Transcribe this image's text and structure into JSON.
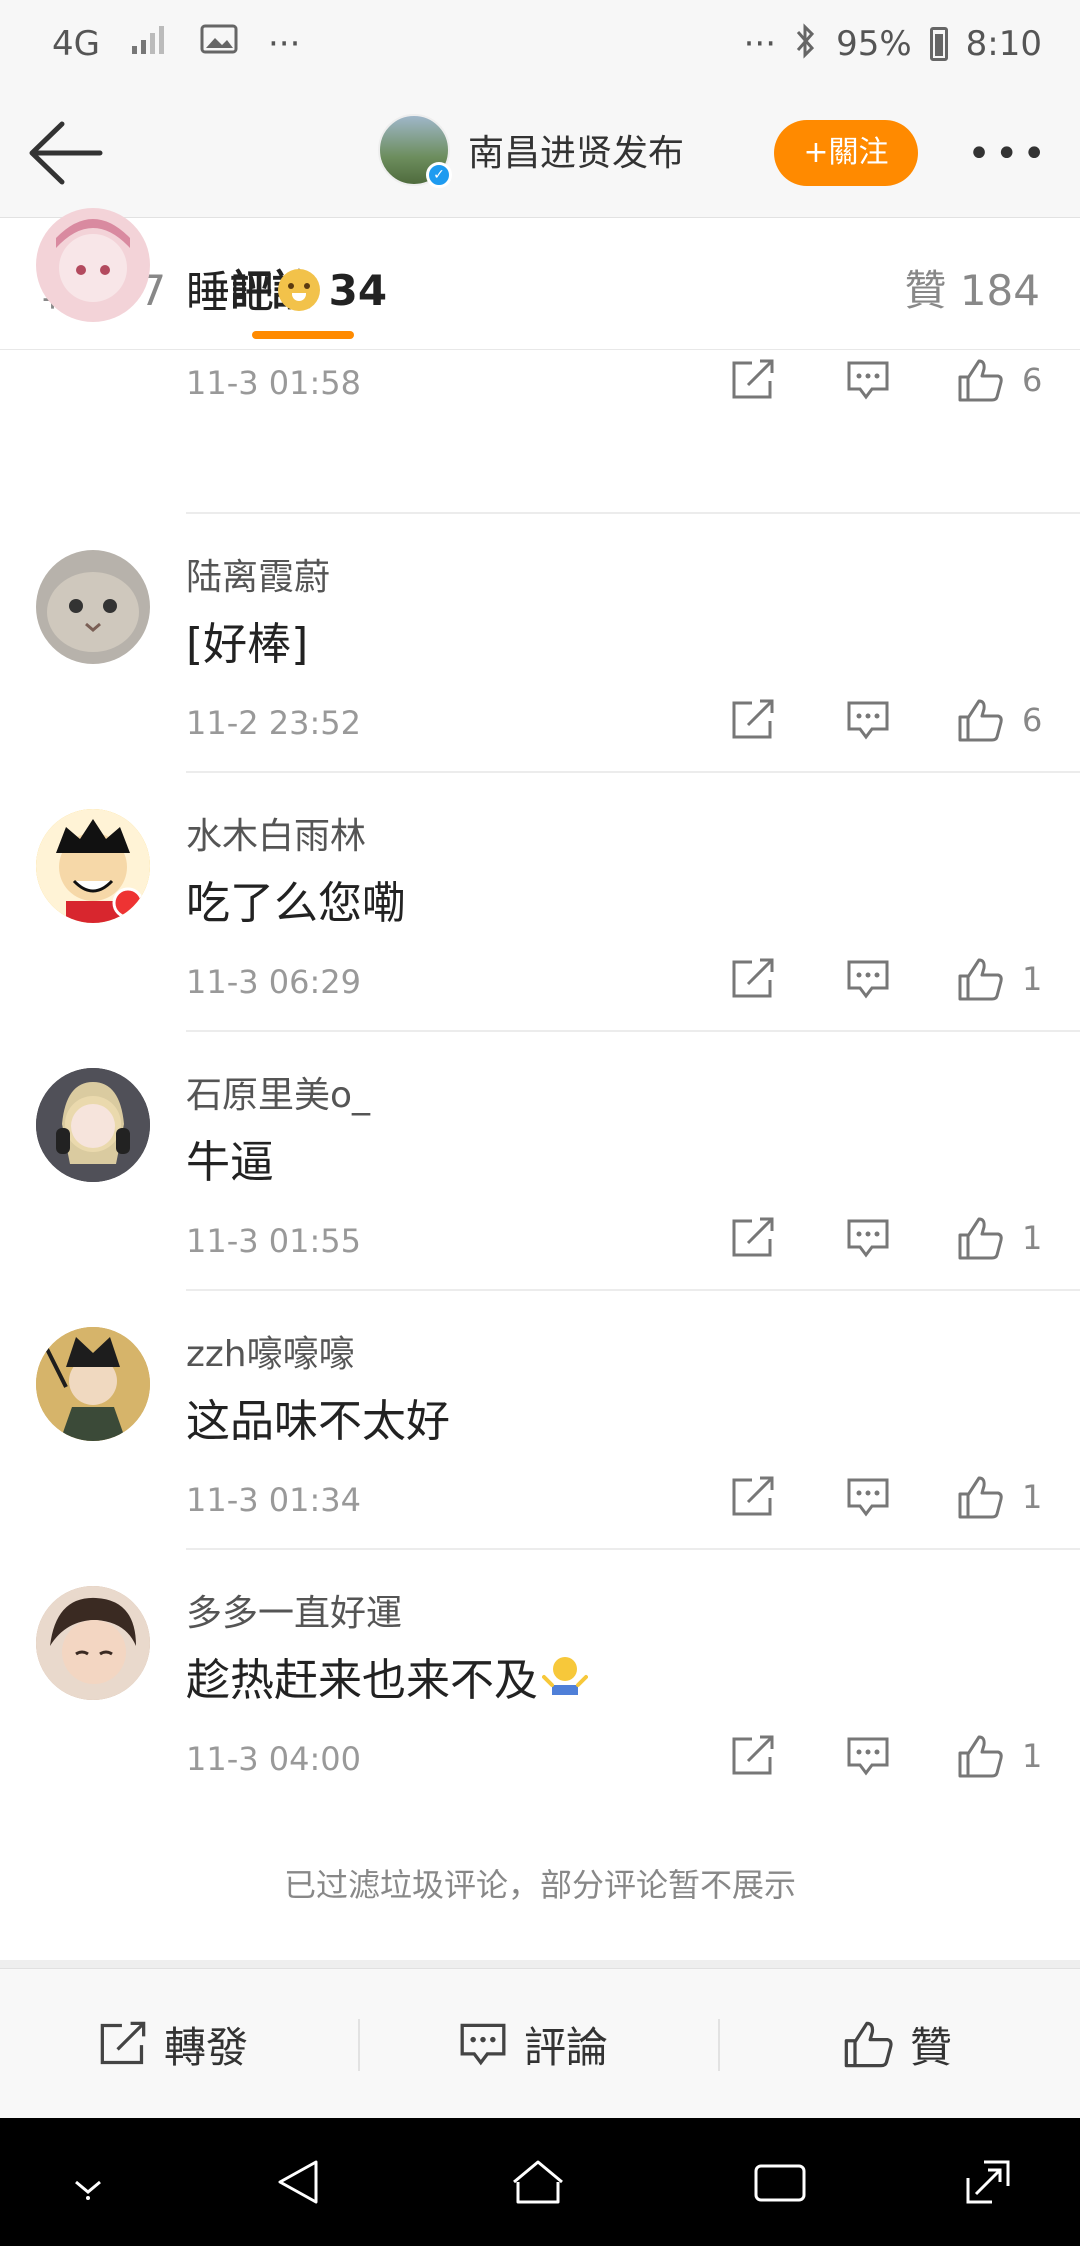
{
  "status_bar": {
    "network": "4G",
    "more": "···",
    "more_right": "···",
    "battery": "95%",
    "time": "8:10"
  },
  "header": {
    "title": "南昌进贤发布",
    "follow_label": "+關注",
    "more_label": "•••"
  },
  "tabs": {
    "repost": "轉發 7",
    "comments": "評論 34",
    "likes": "贊 184"
  },
  "comments": [
    {
      "user": "",
      "text": "睡吧",
      "time": "11-3 01:58",
      "likes": "6",
      "avatar_color": "#f3d3d8"
    },
    {
      "user": "陆离霞蔚",
      "text": "[好棒]",
      "time": "11-2 23:52",
      "likes": "6",
      "avatar_color": "#b7b2ab"
    },
    {
      "user": "水木白雨林",
      "text": "吃了么您嘞",
      "time": "11-3 06:29",
      "likes": "1",
      "avatar_color": "#f4c13a"
    },
    {
      "user": "石原里美o_",
      "text": "牛逼",
      "time": "11-3 01:55",
      "likes": "1",
      "avatar_color": "#3e3e44"
    },
    {
      "user": "zzh嚎嚎嚎",
      "text": "这品味不太好",
      "time": "11-3 01:34",
      "likes": "1",
      "avatar_color": "#c9a75b"
    },
    {
      "user": "多多一直好運",
      "text": "趁热赶来也来不及",
      "time": "11-3 04:00",
      "likes": "1",
      "avatar_color": "#caa68c"
    }
  ],
  "filter_note": "已过滤垃圾评论，部分评论暂不展示",
  "bottom_bar": {
    "repost": "轉發",
    "comment": "評論",
    "like": "贊"
  },
  "colors": {
    "accent": "#ff8a00",
    "verified": "#1e9bf0"
  }
}
